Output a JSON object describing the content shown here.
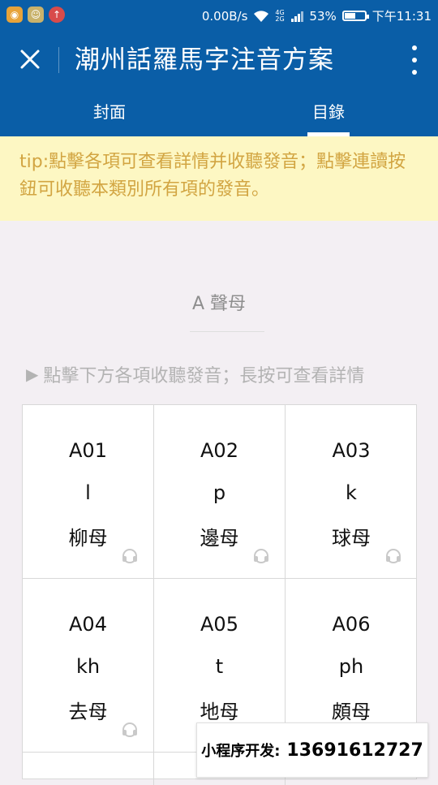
{
  "status_bar": {
    "speed": "0.00B/s",
    "network": "4G 2G",
    "battery_text": "53%",
    "battery_level": 0.53,
    "time": "下午11:31"
  },
  "app_bar": {
    "title": "潮州話羅馬字注音方案"
  },
  "tabs": [
    {
      "label": "封面",
      "active": false
    },
    {
      "label": "目錄",
      "active": true
    }
  ],
  "tip": {
    "text": "tip:點擊各項可查看詳情并收聽發音；點擊連讀按鈕可收聽本類別所有項的發音。"
  },
  "section": {
    "title": "A 聲母",
    "hint": "點擊下方各項收聽發音；長按可查看詳情"
  },
  "items": [
    {
      "code": "A01",
      "letter": "l",
      "name": "柳母"
    },
    {
      "code": "A02",
      "letter": "p",
      "name": "邊母"
    },
    {
      "code": "A03",
      "letter": "k",
      "name": "球母"
    },
    {
      "code": "A04",
      "letter": "kh",
      "name": "去母"
    },
    {
      "code": "A05",
      "letter": "t",
      "name": "地母"
    },
    {
      "code": "A06",
      "letter": "ph",
      "name": "頗母"
    }
  ],
  "watermark": {
    "label": "小程序开发:",
    "phone": "13691612727"
  },
  "colors": {
    "primary": "#0a5ea7",
    "tip_background": "#fdf7c3",
    "tip_text": "#d2a542"
  }
}
